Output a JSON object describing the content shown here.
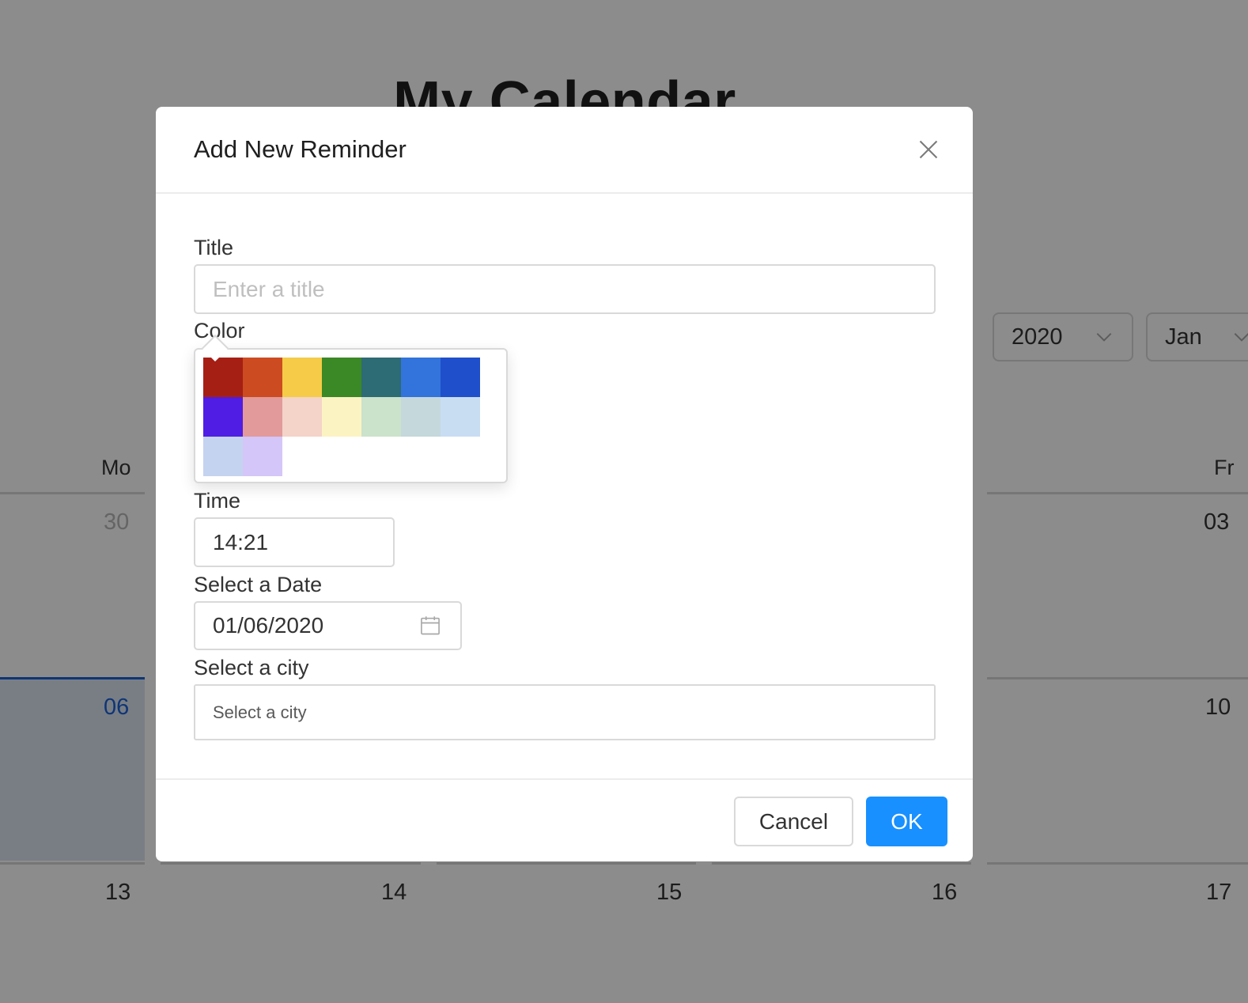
{
  "calendar": {
    "title": "My Calendar",
    "year_select": "2020",
    "month_select": "Jan",
    "day_headers": [
      "Mo",
      "Fr"
    ],
    "week1": [
      "30",
      "03"
    ],
    "week2": [
      "06",
      "10"
    ],
    "week3": [
      "13",
      "14",
      "15",
      "16",
      "17"
    ]
  },
  "modal": {
    "title": "Add New Reminder",
    "title_field": {
      "label": "Title",
      "value": "",
      "placeholder": "Enter a title"
    },
    "color_field": {
      "label": "Color",
      "swatches": [
        "#a61f15",
        "#cc4b21",
        "#f5cb47",
        "#3b8826",
        "#2d6b75",
        "#3274db",
        "#1f4fcb",
        "#4f1de3",
        "#e29a9a",
        "#f4d3c9",
        "#fcf3c3",
        "#cbe2cb",
        "#c5d8dc",
        "#c9ddf2",
        "#c4d3ef",
        "#d4c6f8"
      ]
    },
    "time_field": {
      "label": "Time",
      "value": "14:21"
    },
    "date_field": {
      "label": "Select a Date",
      "value": "01/06/2020"
    },
    "city_field": {
      "label": "Select a city",
      "placeholder": "Select a city"
    },
    "buttons": {
      "cancel": "Cancel",
      "ok": "OK"
    }
  },
  "colors": {
    "primary": "#1890ff",
    "overlay": "rgba(0,0,0,0.45)",
    "today": "#1d62d6"
  },
  "icons": {
    "close": "close-icon",
    "calendar": "calendar-icon",
    "chevron": "chevron-down-icon"
  }
}
